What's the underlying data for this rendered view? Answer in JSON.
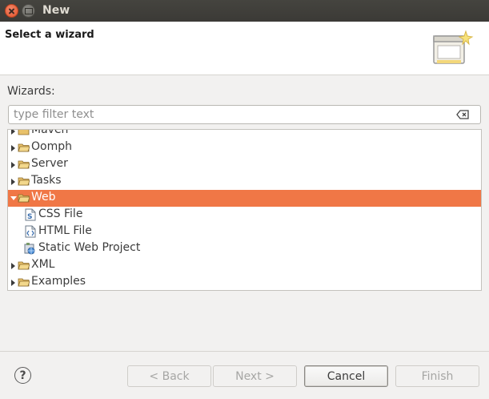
{
  "window": {
    "title": "New"
  },
  "banner": {
    "title": "Select a wizard"
  },
  "wizards_label": "Wizards:",
  "filter": {
    "placeholder": "type filter text",
    "value": ""
  },
  "tree": {
    "partial_top": "Maven",
    "items": [
      {
        "label": "Oomph",
        "expanded": false
      },
      {
        "label": "Server",
        "expanded": false
      },
      {
        "label": "Tasks",
        "expanded": false
      },
      {
        "label": "Web",
        "expanded": true,
        "selected": true
      },
      {
        "label": "CSS File",
        "child": true,
        "icon": "css-file-icon"
      },
      {
        "label": "HTML File",
        "child": true,
        "icon": "html-file-icon"
      },
      {
        "label": "Static Web Project",
        "child": true,
        "icon": "web-project-icon"
      },
      {
        "label": "XML",
        "expanded": false
      },
      {
        "label": "Examples",
        "expanded": false
      }
    ]
  },
  "buttons": {
    "help": "?",
    "back": "< Back",
    "next": "Next >",
    "cancel": "Cancel",
    "finish": "Finish"
  },
  "colors": {
    "selection": "#f07746",
    "titlebar": "#3b3a36",
    "folder": "#e8c16a"
  }
}
